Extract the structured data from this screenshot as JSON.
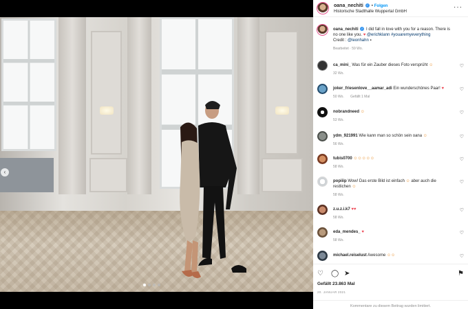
{
  "post": {
    "username": "oana_nechiti",
    "follow_label": "Folgen",
    "location": "Historische Stadthalle Wuppertal GmbH",
    "caption_text": "I did fall in love with you for a reason. There is no one like you.",
    "caption_mention": "@erichklann",
    "caption_hashtag": "#youaremyeverything",
    "caption_credit": "Credit :",
    "caption_credit_mention": "@leonhahn",
    "edited_meta": "Bearbeitet · 59 Wo.",
    "likes": "Gefällt 23.863 Mal",
    "date": "20. JANUAR 2021",
    "comments_limited": "Kommentare zu diesem Beitrag wurden limitiert."
  },
  "comments": [
    {
      "user": "ca_mini_",
      "text": "Was für ein Zauber dieses Foto versprüht",
      "emoji": "☺",
      "time": "32 Wo.",
      "likes": ""
    },
    {
      "user": "joker_friesenlove__aamar_adi",
      "text": "Ein wunderschönes Paar!",
      "emoji": "♥",
      "time": "50 Wo.",
      "likes": "Gefällt 1 Mal"
    },
    {
      "user": "nobrandneed",
      "text": "",
      "emoji": "☺",
      "time": "53 Wo.",
      "likes": ""
    },
    {
      "user": "ydm_921991",
      "text": "Wie kann man so schön sein oana",
      "emoji": "☺",
      "time": "56 Wo.",
      "likes": ""
    },
    {
      "user": "tubis0700",
      "text": "",
      "emoji": "☺☺☺☺☺",
      "time": "58 Wo.",
      "likes": ""
    },
    {
      "user": "popiiip",
      "text": "Wow! Das erste Bild ist einfach",
      "text2": "aber auch die restlichen",
      "emoji": "☺",
      "time": "58 Wo.",
      "likes": ""
    },
    {
      "user": "z.u.z.i.k7",
      "text": "",
      "emoji": "♥♥",
      "time": "58 Wo.",
      "likes": ""
    },
    {
      "user": "eda_mendes_",
      "text": "",
      "emoji": "♥",
      "time": "58 Wo.",
      "likes": ""
    },
    {
      "user": "michael.reiselust",
      "text": "Awesome",
      "emoji": "☺☺",
      "time": "",
      "likes": ""
    }
  ],
  "icons": {
    "heart": "heart-icon",
    "comment": "comment-icon",
    "share": "share-icon",
    "save": "bookmark-icon",
    "more": "more-options-icon"
  },
  "colors": {
    "link": "#00376b",
    "follow": "#0095f6",
    "heart": "#ed4956"
  }
}
